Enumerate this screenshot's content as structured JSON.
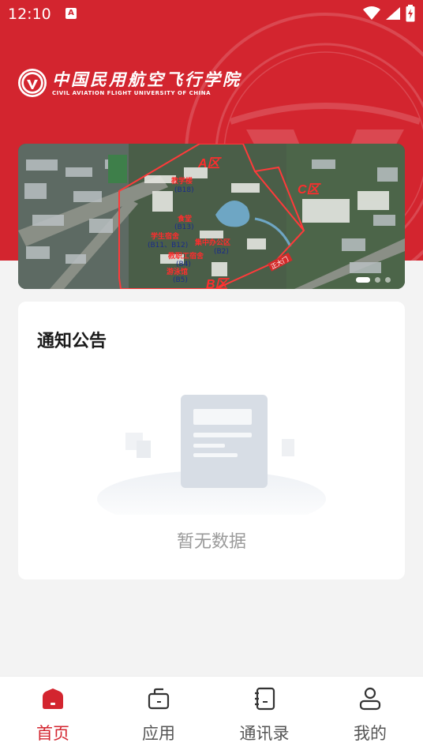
{
  "status_bar": {
    "time": "12:10",
    "notification_icon": "a-notification-icon",
    "icons": [
      "wifi-icon",
      "cellular-signal-icon",
      "battery-charging-icon"
    ]
  },
  "header": {
    "logo_name_cn": "中国民用航空飞行学院",
    "logo_name_en": "CIVIL AVIATION FLIGHT UNIVERSITY OF CHINA",
    "brand_color": "#d3252f"
  },
  "banner": {
    "labels": {
      "zone_a": "A区",
      "zone_b": "B区",
      "zone_c": "C区",
      "teaching_building": "教学楼",
      "teaching_building_code": "(B18)",
      "canteen": "食堂",
      "canteen_code": "(B13)",
      "student_dorm": "学生宿舍",
      "student_dorm_code": "(B11、B12)",
      "staff_dorm": "教职工宿舍",
      "staff_dorm_code": "(B4)",
      "office_area": "集中办公区",
      "office_area_code": "(B2)",
      "swimming_hall": "游泳馆",
      "swimming_hall_code": "(B5)",
      "main_gate": "正大门"
    },
    "page_count": 3,
    "active_page": 1
  },
  "notice": {
    "title": "通知公告",
    "empty_text": "暂无数据"
  },
  "tabbar": {
    "items": [
      {
        "label": "首页",
        "icon": "home-icon",
        "active": true
      },
      {
        "label": "应用",
        "icon": "briefcase-icon",
        "active": false
      },
      {
        "label": "通讯录",
        "icon": "contacts-book-icon",
        "active": false
      },
      {
        "label": "我的",
        "icon": "user-icon",
        "active": false
      }
    ],
    "active_color": "#d3252f",
    "inactive_color": "#555555"
  }
}
